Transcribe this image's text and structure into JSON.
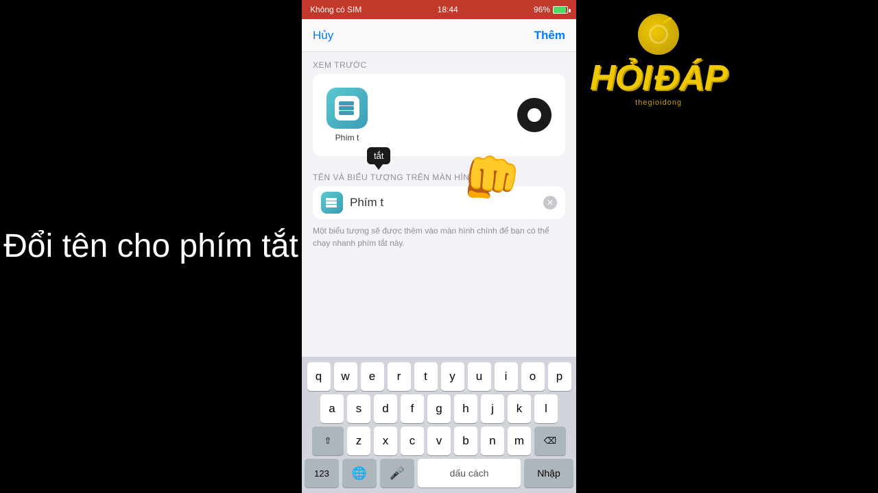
{
  "statusBar": {
    "carrier": "Không có SIM",
    "time": "18:44",
    "battery": "96%"
  },
  "navBar": {
    "cancelLabel": "Hủy",
    "addLabel": "Thêm"
  },
  "preview": {
    "sectionLabel": "XEM TRƯỚC",
    "appName": "Phím t"
  },
  "nameSection": {
    "sectionLabel": "TÊN VÀ BIỂU TƯỢNG TRÊN MÀN HÌNH",
    "inputValue": "Phím t",
    "helperText": "Một biểu tượng sẽ được thêm vào màn hình chính để bạn có thể chạy nhanh phím tắt này."
  },
  "tooltip": {
    "label": "tắt"
  },
  "keyboard": {
    "row1": [
      "q",
      "w",
      "e",
      "r",
      "t",
      "y",
      "u",
      "i",
      "o",
      "p"
    ],
    "row2": [
      "a",
      "s",
      "d",
      "f",
      "g",
      "h",
      "j",
      "k",
      "l"
    ],
    "row3": [
      "z",
      "x",
      "c",
      "v",
      "b",
      "n",
      "m"
    ],
    "spaceLabel": "dấu cách",
    "returnLabel": "Nhập",
    "numLabel": "123",
    "deleteIcon": "⌫"
  },
  "leftText": "Đổi tên cho\nphím tắt",
  "logo": {
    "hoi": "HỎI",
    "dap": "ĐÁP",
    "subtitle": "thegioidong"
  }
}
